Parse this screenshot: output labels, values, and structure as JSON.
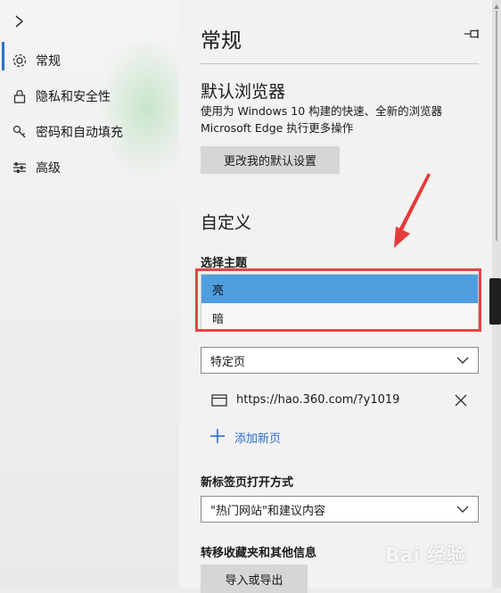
{
  "nav": {
    "items": [
      {
        "icon": "gear-icon",
        "label": "常规"
      },
      {
        "icon": "lock-icon",
        "label": "隐私和安全性"
      },
      {
        "icon": "key-icon",
        "label": "密码和自动填充"
      },
      {
        "icon": "sliders-icon",
        "label": "高级"
      }
    ]
  },
  "panel": {
    "title": "常规",
    "default_browser": {
      "heading": "默认浏览器",
      "desc_line1": "使用为 Windows 10 构建的快速、全新的浏览器",
      "desc_line2": "Microsoft Edge 执行更多操作",
      "button": "更改我的默认设置"
    },
    "customize": {
      "heading": "自定义",
      "theme_label": "选择主题",
      "theme_options": [
        "亮",
        "暗"
      ],
      "theme_selected": "亮",
      "open_with_value": "特定页",
      "page_url": "https://hao.360.com/?y1019",
      "add_page": "添加新页",
      "newtab_label": "新标签页打开方式",
      "newtab_value": "\"热门网站\"和建议内容",
      "transfer_label": "转移收藏夹和其他信息",
      "transfer_button": "导入或导出"
    }
  },
  "watermark": "Bai 经验",
  "colors": {
    "accent": "#2b6fc9",
    "selected_option": "#4f9fe0",
    "highlight_box": "#e64545",
    "arrow": "#e53b3b"
  }
}
